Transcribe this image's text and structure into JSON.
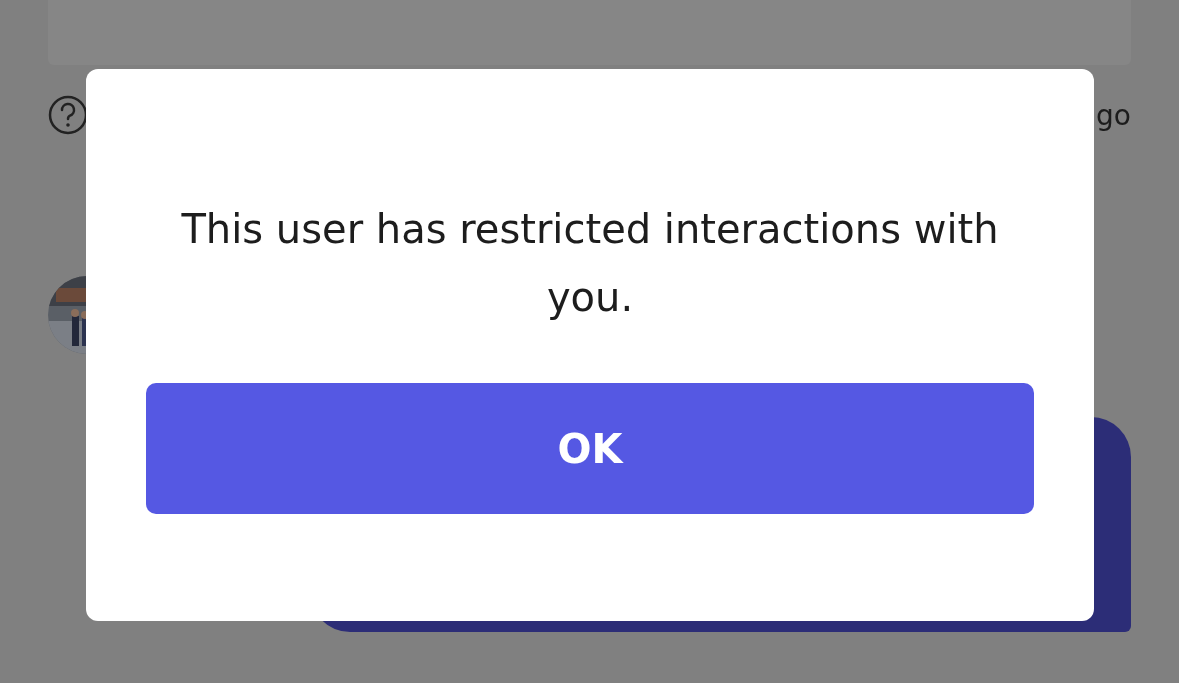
{
  "background": {
    "timestamp_fragment": "go"
  },
  "dialog": {
    "message": "This user has restricted interactions with you.",
    "button": "OK"
  }
}
